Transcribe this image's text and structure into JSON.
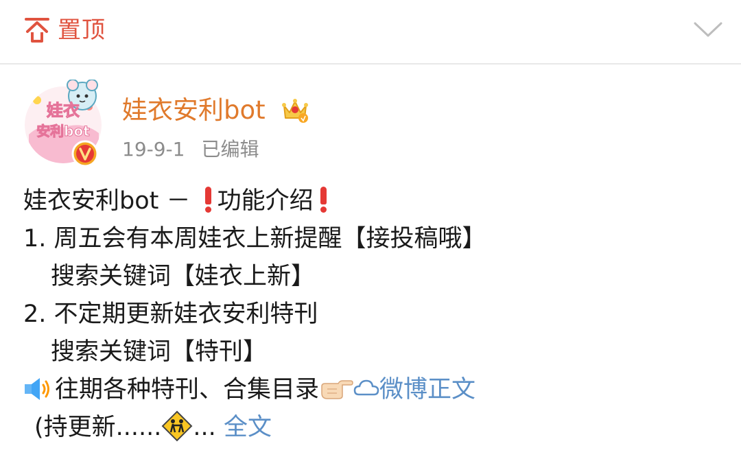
{
  "header": {
    "pinned_label": "置顶",
    "icons": {
      "pin": "pin-top-icon",
      "collapse": "chevron-down-icon"
    }
  },
  "post": {
    "author": "娃衣安利bot",
    "date": "19-9-1",
    "edited": "已编辑",
    "badges": {
      "verified": "verified-v-icon",
      "vip": "vip-crown-icon"
    },
    "avatar_text": [
      "娃衣",
      "安利bot"
    ],
    "lines": {
      "l1_a": "娃衣安利bot －",
      "l1_b": "功能介绍",
      "l2": "1. 周五会有本周娃衣上新提醒【接投稿哦】",
      "l3": "搜索关键词【娃衣上新】",
      "l4": "2. 不定期更新娃衣安利特刊",
      "l5": "搜索关键词【特刊】",
      "l6_text": "往期各种特刊、合集目录",
      "l6_link": "微博正文",
      "l7_text": "(持更新......",
      "l7_ellipsis": "...",
      "l7_more": "全文"
    }
  },
  "colors": {
    "pin_accent": "#e0533f",
    "username": "#e07a2c",
    "meta": "#8c8c8c",
    "link": "#5b8fc7"
  }
}
